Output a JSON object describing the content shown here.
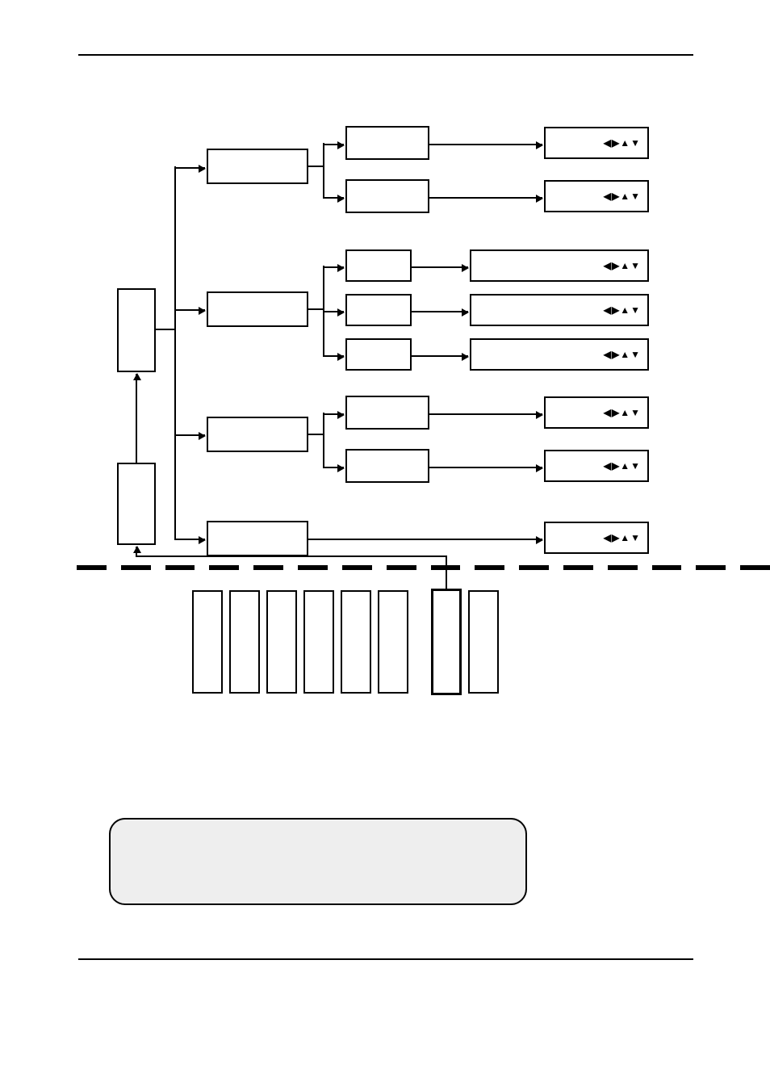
{
  "glyphs": {
    "nav": "◀▶▲▼"
  }
}
